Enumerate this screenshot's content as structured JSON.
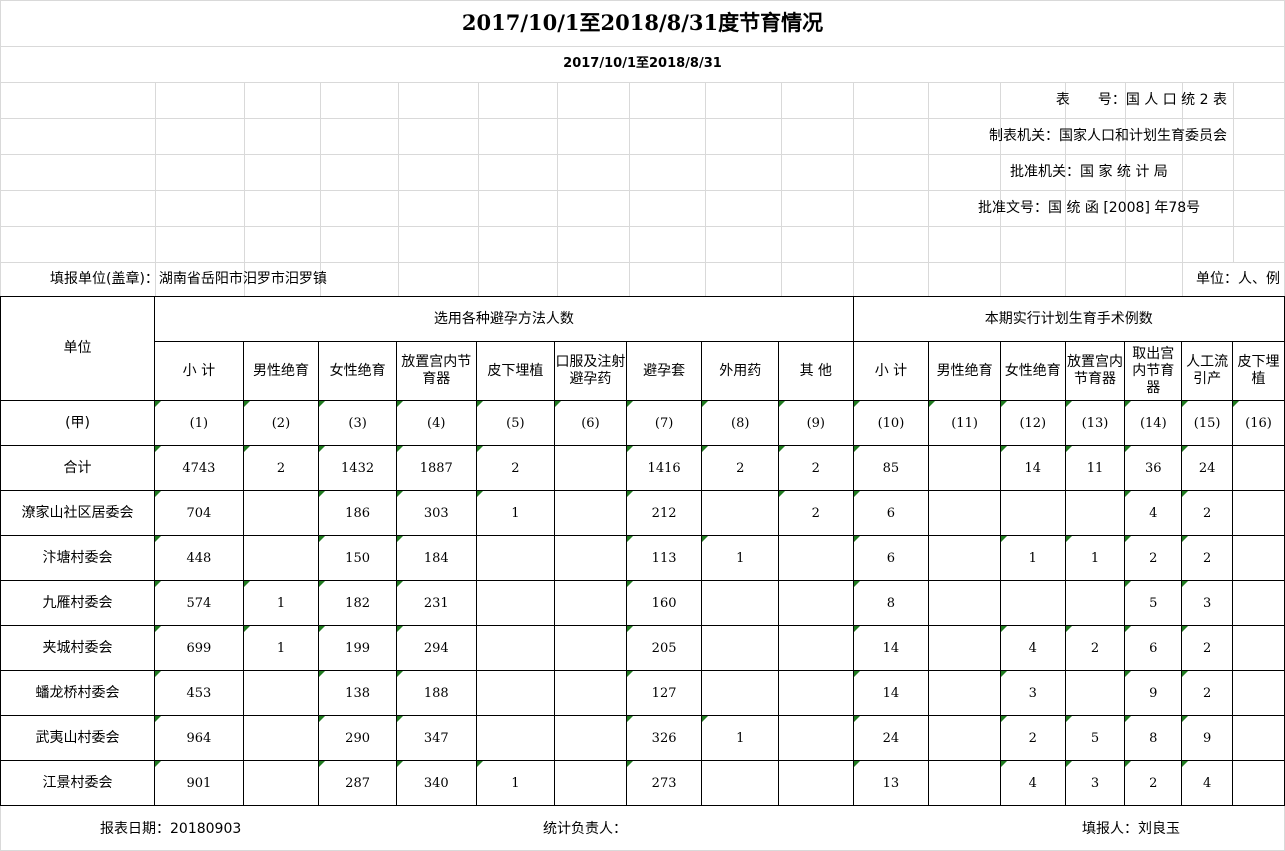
{
  "title": "2017/10/1至2018/8/31度节育情况",
  "subtitle": "2017/10/1至2018/8/31",
  "meta": [
    "表　　号：国 人 口 统 2 表",
    "制表机关：国家人口和计划生育委员会",
    "批准机关：国 家 统 计 局",
    "批准文号：国 统 函 [2008] 年78号"
  ],
  "fill_unit": "填报单位(盖章)：湖南省岳阳市汨罗市汨罗镇",
  "unit": "单位：人、例",
  "header": {
    "unit_col": "单位",
    "group1": "选用各种避孕方法人数",
    "group2": "本期实行计划生育手术例数",
    "cols": [
      "小 计",
      "男性绝育",
      "女性绝育",
      "放置宫内节育器",
      "皮下埋植",
      "口服及注射避孕药",
      "避孕套",
      "外用药",
      "其 他",
      "小 计",
      "男性绝育",
      "女性绝育",
      "放置宫内节育器",
      "取出宫内节育器",
      "人工流引产",
      "皮下埋植"
    ],
    "codes": [
      "(甲)",
      "(1)",
      "(2)",
      "(3)",
      "(4)",
      "(5)",
      "(6)",
      "(7)",
      "(8)",
      "(9)",
      "(10)",
      "(11)",
      "(12)",
      "(13)",
      "(14)",
      "(15)",
      "(16)"
    ]
  },
  "rows": [
    {
      "name": "合计",
      "v": [
        "4743",
        "2",
        "1432",
        "1887",
        "2",
        "",
        "1416",
        "2",
        "2",
        "85",
        "",
        "14",
        "11",
        "36",
        "24",
        ""
      ]
    },
    {
      "name": "潦家山社区居委会",
      "v": [
        "704",
        "",
        "186",
        "303",
        "1",
        "",
        "212",
        "",
        "2",
        "6",
        "",
        "",
        "",
        "4",
        "2",
        ""
      ]
    },
    {
      "name": "汴塘村委会",
      "v": [
        "448",
        "",
        "150",
        "184",
        "",
        "",
        "113",
        "1",
        "",
        "6",
        "",
        "1",
        "1",
        "2",
        "2",
        ""
      ]
    },
    {
      "name": "九雁村委会",
      "v": [
        "574",
        "1",
        "182",
        "231",
        "",
        "",
        "160",
        "",
        "",
        "8",
        "",
        "",
        "",
        "5",
        "3",
        ""
      ]
    },
    {
      "name": "夹城村委会",
      "v": [
        "699",
        "1",
        "199",
        "294",
        "",
        "",
        "205",
        "",
        "",
        "14",
        "",
        "4",
        "2",
        "6",
        "2",
        ""
      ]
    },
    {
      "name": "蟠龙桥村委会",
      "v": [
        "453",
        "",
        "138",
        "188",
        "",
        "",
        "127",
        "",
        "",
        "14",
        "",
        "3",
        "",
        "9",
        "2",
        ""
      ]
    },
    {
      "name": "武夷山村委会",
      "v": [
        "964",
        "",
        "290",
        "347",
        "",
        "",
        "326",
        "1",
        "",
        "24",
        "",
        "2",
        "5",
        "8",
        "9",
        ""
      ]
    },
    {
      "name": "江景村委会",
      "v": [
        "901",
        "",
        "287",
        "340",
        "1",
        "",
        "273",
        "",
        "",
        "13",
        "",
        "4",
        "3",
        "2",
        "4",
        ""
      ]
    }
  ],
  "footer": {
    "report_date": "报表日期：20180903",
    "stat_person": "统计负责人：",
    "filler": "填报人：刘良玉"
  }
}
